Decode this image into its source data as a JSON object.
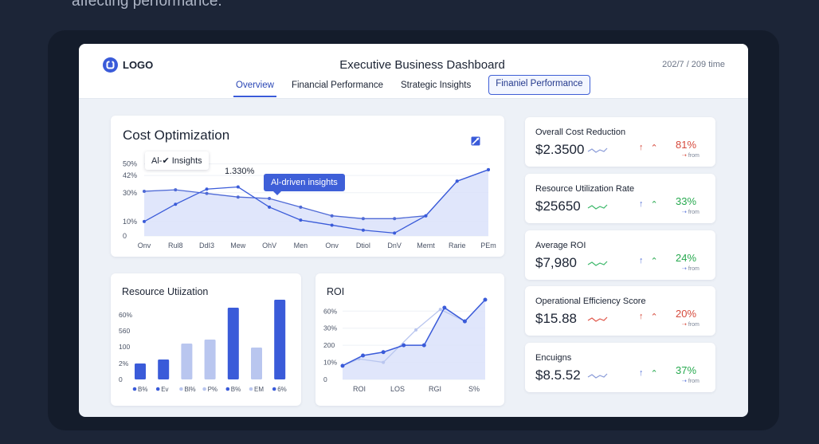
{
  "caption": "affecting performance.",
  "header": {
    "logo_text": "LOGO",
    "title": "Executive Business Dashboard",
    "time": "202/7 / 209 time",
    "tabs": [
      {
        "label": "Overview",
        "active": true
      },
      {
        "label": "Financial Performance",
        "active": false
      },
      {
        "label": "Strategic Insights",
        "active": false
      },
      {
        "label": "Finaniel Performance",
        "active": false,
        "boxed": true
      }
    ]
  },
  "cost_card": {
    "title": "Cost Optimization",
    "icon": "chart-edit-icon",
    "tooltip_ai": "Al-✔ Insights",
    "tooltip_pct": "1.330%",
    "tooltip_blue": "Al-driven insights"
  },
  "resource_card": {
    "title": "Resource Utiization"
  },
  "roi_card": {
    "title": "ROI"
  },
  "kpis": [
    {
      "label": "Overall Cost Reduction",
      "value": "$2.3500",
      "pct": "81%",
      "sub": "from",
      "trend": "down",
      "pct_color": "#d64a3c",
      "spark_color": "#8a9bd8"
    },
    {
      "label": "Resource Utilization Rate",
      "value": "$25650",
      "pct": "33%",
      "sub": "from",
      "trend": "up",
      "pct_color": "#27a94f",
      "spark_color": "#3cb86a"
    },
    {
      "label": "Average ROI",
      "value": "$7,980",
      "pct": "24%",
      "sub": "from",
      "trend": "up",
      "pct_color": "#27a94f",
      "spark_color": "#3cb86a"
    },
    {
      "label": "Operational Efficiency Score",
      "value": "$15.88",
      "pct": "20%",
      "sub": "from",
      "trend": "down",
      "pct_color": "#d64a3c",
      "spark_color": "#e0574a"
    },
    {
      "label": "Encuigns",
      "value": "$8.5.52",
      "pct": "37%",
      "sub": "from",
      "trend": "up",
      "pct_color": "#27a94f",
      "spark_color": "#8a9bd8"
    }
  ],
  "colors": {
    "accent": "#3a5bd9",
    "light": "#b9c6ef",
    "area": "#dbe2fa"
  },
  "chart_data": [
    {
      "type": "line",
      "title": "Cost Optimization",
      "y_tick_labels": [
        "0",
        "10%",
        "30%",
        "42%",
        "50%"
      ],
      "y_ticks": [
        0,
        10,
        30,
        42,
        50
      ],
      "ylim": [
        0,
        52
      ],
      "categories": [
        "Onv",
        "Rul8",
        "DdI3",
        "Mew",
        "OhV",
        "Men",
        "Onv",
        "Dtiol",
        "DnV",
        "Memt",
        "Rarie",
        "PEm"
      ],
      "series": [
        {
          "values": [
            31,
            32,
            29.5,
            27,
            26,
            20,
            14,
            12,
            12,
            14,
            38,
            46
          ],
          "style": "area"
        },
        {
          "values": [
            10,
            22,
            32.5,
            34,
            20,
            11,
            7.5,
            4,
            2,
            14,
            38,
            46
          ],
          "style": "line"
        }
      ],
      "grid": true
    },
    {
      "type": "bar",
      "title": "Resource Utiization",
      "y_tick_labels": [
        "0",
        "2%",
        "100",
        "560",
        "60%"
      ],
      "categories": [
        "B%",
        "Ev",
        "Bl%",
        "P%",
        "B%",
        "EM",
        "6%"
      ],
      "values": [
        20,
        25,
        45,
        50,
        90,
        40,
        100
      ],
      "bar_colors": [
        "#3a5bd9",
        "#3a5bd9",
        "#b9c6ef",
        "#b9c6ef",
        "#3a5bd9",
        "#b9c6ef",
        "#3a5bd9"
      ],
      "ylim": [
        0,
        100
      ]
    },
    {
      "type": "line",
      "title": "ROI",
      "y_tick_labels": [
        "0",
        "10%",
        "200",
        "30%",
        "60%"
      ],
      "y_ticks": [
        0,
        10,
        20,
        30,
        40
      ],
      "ylim": [
        0,
        42
      ],
      "categories": [
        "ROI",
        "LOS",
        "RGI",
        "S%"
      ],
      "series": [
        {
          "x": [
            0,
            0.5,
            1,
            1.5,
            2,
            2.5,
            3,
            3.5
          ],
          "values": [
            8,
            14,
            16,
            20,
            20,
            42,
            34,
            50
          ],
          "style": "area"
        },
        {
          "x": [
            0,
            0.4,
            1,
            1.8,
            2.4,
            3,
            3.5
          ],
          "values": [
            8,
            12,
            10,
            29,
            41,
            34,
            50
          ],
          "style": "line-light"
        }
      ],
      "grid": true
    }
  ]
}
